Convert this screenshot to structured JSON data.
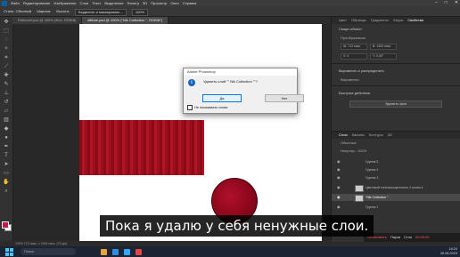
{
  "menu": {
    "items": [
      "Файл",
      "Редактирование",
      "Изображение",
      "Слои",
      "Текст",
      "Выделение",
      "Фильтр",
      "3D",
      "Просмотр",
      "Окно",
      "Справка"
    ]
  },
  "options": {
    "items": [
      "Стиль: Обычный",
      "Ширина:",
      "Высота:",
      "Выделить и маскировать..."
    ],
    "zoom": "100%"
  },
  "tabs": [
    {
      "label": "Рабочий.psd @ 400% (Фон, RGB/8)"
    },
    {
      "label": "diffuse.psd @ 100% (\"Nik Collection \", RGB/8*)"
    }
  ],
  "right_panel": {
    "tabs": [
      "Цвет",
      "Образцы",
      "Градиенты",
      "Узоры",
      "Свойства"
    ],
    "section_title": "Смарт-объект",
    "props_label": "Преобразовать",
    "inputs": [
      "Ш: 713 пикс.",
      "В: 1349 пикс.",
      "X: 0",
      "Y: 0,00°"
    ],
    "align_title": "Выровнять и распределить",
    "align_sub": "Выровнять:",
    "qa_title": "Быстрые действия",
    "qa_button": "Удалить фон"
  },
  "layers_panel": {
    "tabs": [
      "Слои",
      "Каналы",
      "Контуры",
      "3D"
    ],
    "mode": "Обычные",
    "opacity": "Непрозр.: 100%",
    "items": [
      {
        "name": "Группа 5"
      },
      {
        "name": "Группа 4"
      },
      {
        "name": "Группа 3"
      },
      {
        "name": "Цветовой тон/насыщенность 4 копия 4"
      },
      {
        "name": "\"Nik Collection \""
      },
      {
        "name": "Группа 1"
      }
    ]
  },
  "dialog": {
    "title": "Adobe Photoshop",
    "message": "Удалить слой \"\" Nik Collection \"\"?",
    "yes": "Да",
    "no": "Нет",
    "checkbox": "Не показывать снова"
  },
  "statusbar": {
    "text": "100%    713 пикс. x 1349 пикс. (72 ppi)"
  },
  "notification": {
    "items": [
      "Остановить",
      "Пауза",
      "Стоп"
    ],
    "time": "00:09:20"
  },
  "taskbar": {
    "search_placeholder": "Поиск",
    "time": "16:24",
    "date": "26.06.2023"
  },
  "subtitle": "Пока я удалю у себя ненужные слои.",
  "colors": {
    "accent": "#0078d7",
    "foreground_swatch": "#c21b4a"
  }
}
